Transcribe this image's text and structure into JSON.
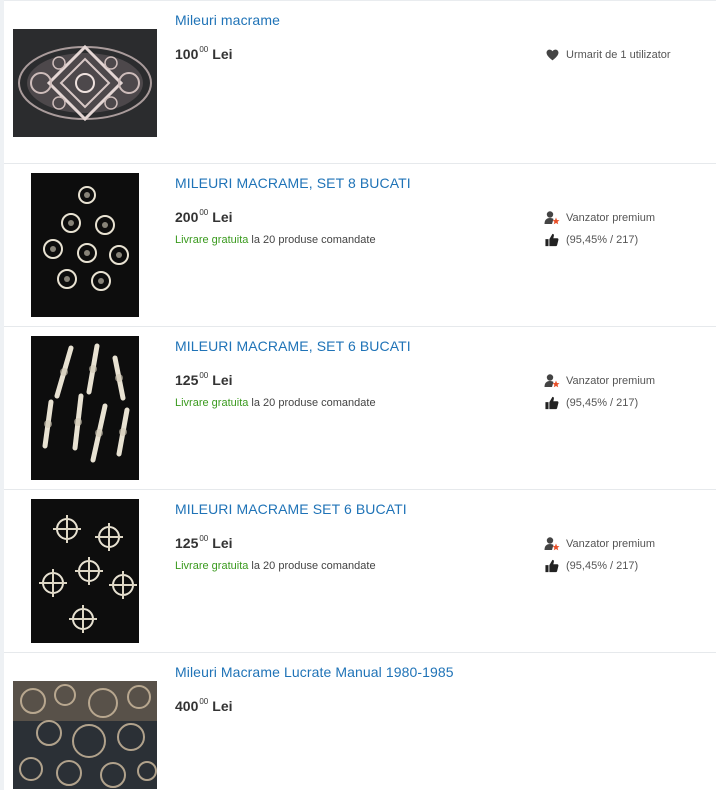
{
  "listings": [
    {
      "title": "Mileuri macrame",
      "price_int": "100",
      "price_dec": "00",
      "currency": "Lei",
      "follow_text": "Urmarit de 1 utilizator"
    },
    {
      "title": "MILEURI MACRAME, SET 8 BUCATI",
      "price_int": "200",
      "price_dec": "00",
      "currency": "Lei",
      "shipping_free": "Livrare gratuita",
      "shipping_rest": " la 20 produse comandate",
      "seller_badge": "Vanzator premium",
      "rating": "(95,45% / 217)"
    },
    {
      "title": "MILEURI MACRAME, SET 6 BUCATI",
      "price_int": "125",
      "price_dec": "00",
      "currency": "Lei",
      "shipping_free": "Livrare gratuita",
      "shipping_rest": " la 20 produse comandate",
      "seller_badge": "Vanzator premium",
      "rating": "(95,45% / 217)"
    },
    {
      "title": "MILEURI MACRAME SET 6 BUCATI",
      "price_int": "125",
      "price_dec": "00",
      "currency": "Lei",
      "shipping_free": "Livrare gratuita",
      "shipping_rest": " la 20 produse comandate",
      "seller_badge": "Vanzator premium",
      "rating": "(95,45% / 217)"
    },
    {
      "title": "Mileuri Macrame Lucrate Manual 1980-1985",
      "price_int": "400",
      "price_dec": "00",
      "currency": "Lei"
    }
  ],
  "colors": {
    "title_link": "#1f73b7",
    "free_shipping": "#3a9a1e",
    "premium_star": "#e8502a"
  }
}
